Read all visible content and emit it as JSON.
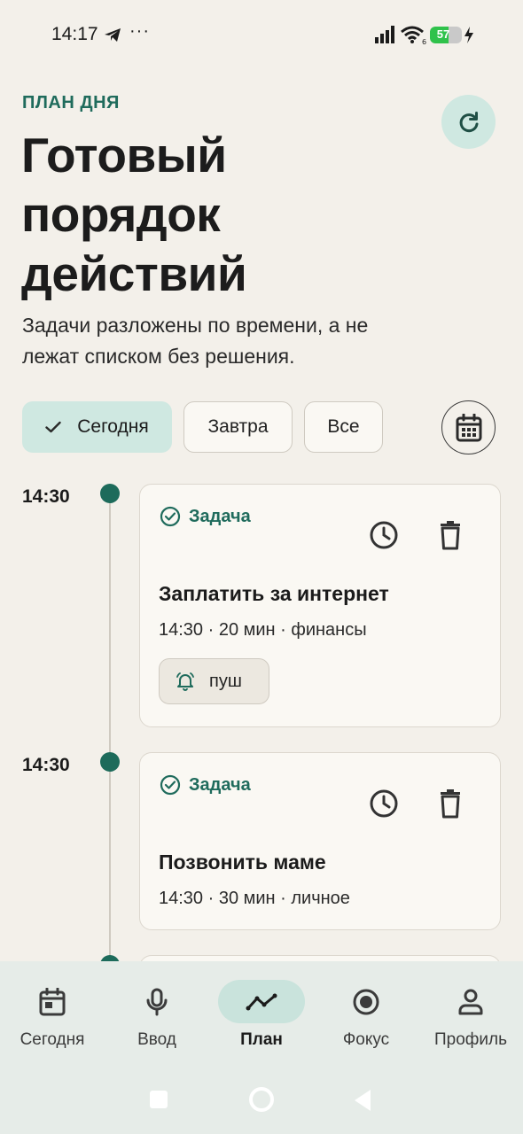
{
  "status_bar": {
    "time": "14:17",
    "dots": "···",
    "battery": "57",
    "battery_level": 0.57,
    "icons": [
      "telegram-icon",
      "signal-icon",
      "wifi-icon",
      "battery-icon",
      "charging-icon"
    ]
  },
  "header": {
    "eyebrow": "ПЛАН ДНЯ",
    "title": "Готовый порядок действий",
    "subtitle": "Задачи разложены по времени, а не лежат списком без решения."
  },
  "filters": [
    {
      "label": "Сегодня",
      "active": true
    },
    {
      "label": "Завтра",
      "active": false
    },
    {
      "label": "Все",
      "active": false
    }
  ],
  "timeline": [
    {
      "time": "14:30",
      "type": "Задача",
      "title": "Заплатить за интернет",
      "meta": "14:30 · 20 мин · финансы",
      "chip": "пуш"
    },
    {
      "time": "14:30",
      "type": "Задача",
      "title": "Позвонить маме",
      "meta": "14:30 · 30 мин · личное"
    }
  ],
  "bottom_nav": [
    {
      "label": "Сегодня",
      "icon": "calendar-icon",
      "active": false
    },
    {
      "label": "Ввод",
      "icon": "microphone-icon",
      "active": false
    },
    {
      "label": "План",
      "icon": "trend-line-icon",
      "active": true
    },
    {
      "label": "Фокус",
      "icon": "focus-target-icon",
      "active": false
    },
    {
      "label": "Профиль",
      "icon": "person-icon",
      "active": false
    }
  ],
  "colors": {
    "accent": "#1f6b5c",
    "accent_light": "#cfe8e1",
    "background": "#f3f0ea",
    "card": "#faf8f3",
    "nav_background": "#e6ece8"
  }
}
